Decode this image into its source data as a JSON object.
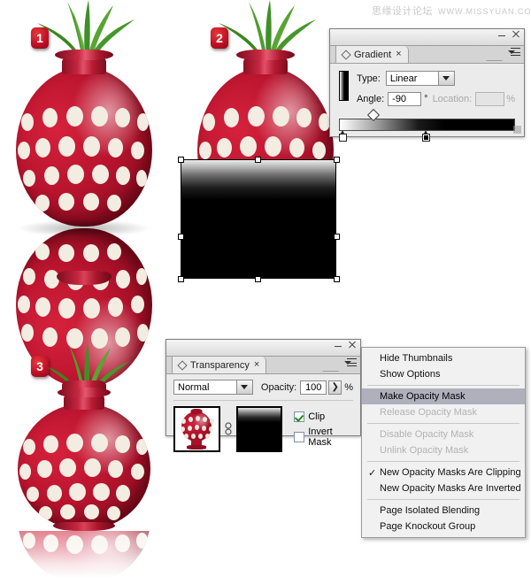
{
  "watermark": {
    "cn": "思缘设计论坛",
    "url": "WWW.MISSYUAN.COM"
  },
  "steps": [
    {
      "badge": "1"
    },
    {
      "badge": "2"
    },
    {
      "badge": "3"
    }
  ],
  "gradient_panel": {
    "tab_label": "Gradient",
    "tab_close": "×",
    "type_label": "Type:",
    "type_value": "Linear",
    "angle_label": "Angle:",
    "angle_value": "-90",
    "degree_symbol": "°",
    "location_label": "Location:",
    "location_value": "",
    "percent_symbol": "%",
    "stops": [
      {
        "position_pct": 0,
        "color": "#ffffff"
      },
      {
        "position_pct": 47,
        "color": "#000000"
      }
    ],
    "midpoint_pct": 17
  },
  "transparency_panel": {
    "tab_label": "Transparency",
    "tab_close": "×",
    "blend_mode": "Normal",
    "opacity_label": "Opacity:",
    "opacity_value": "100",
    "percent_symbol": "%",
    "stepper_glyph": "❯",
    "clip_label": "Clip",
    "clip_checked": true,
    "invert_label": "Invert Mask",
    "invert_checked": false
  },
  "context_menu": {
    "items": [
      {
        "label": "Hide Thumbnails",
        "state": "normal",
        "checked": false
      },
      {
        "label": "Show Options",
        "state": "normal",
        "checked": false
      },
      {
        "separator": true
      },
      {
        "label": "Make Opacity Mask",
        "state": "selected",
        "checked": false
      },
      {
        "label": "Release Opacity Mask",
        "state": "disabled",
        "checked": false
      },
      {
        "separator": true
      },
      {
        "label": "Disable Opacity Mask",
        "state": "disabled",
        "checked": false
      },
      {
        "label": "Unlink Opacity Mask",
        "state": "disabled",
        "checked": false
      },
      {
        "separator": true
      },
      {
        "label": "New Opacity Masks Are Clipping",
        "state": "normal",
        "checked": true
      },
      {
        "label": "New Opacity Masks Are Inverted",
        "state": "normal",
        "checked": false
      },
      {
        "separator": true
      },
      {
        "label": "Page Isolated Blending",
        "state": "normal",
        "checked": false
      },
      {
        "label": "Page Knockout Group",
        "state": "normal",
        "checked": false
      }
    ],
    "check_glyph": "✓"
  },
  "colors": {
    "vase_red": "#b9142e",
    "vase_dot": "#f3ece1",
    "leaf_green": "#3f8f28",
    "badge_red": "#c41126",
    "menu_highlight": "#b0b0bd",
    "panel_bg": "#ebebeb"
  }
}
